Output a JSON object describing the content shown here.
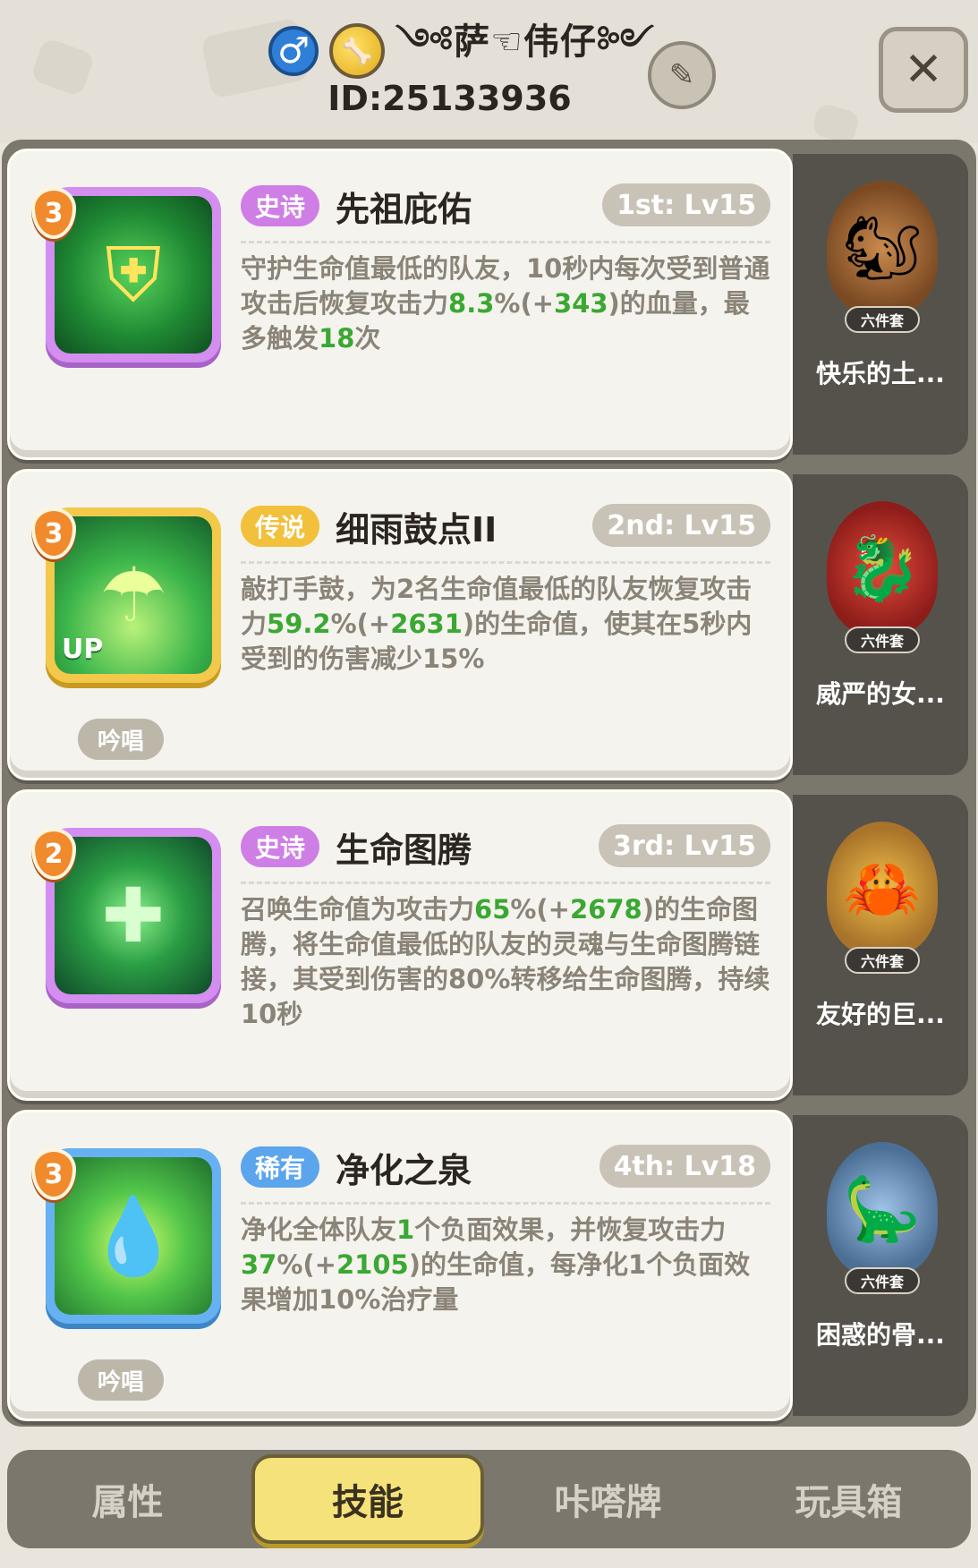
{
  "header": {
    "gender_icon": "male-symbol-icon",
    "player_name": "༺萨☜伟仔༻",
    "player_id": "ID:25133936",
    "edit_icon": "pencil-icon",
    "close_icon": "close-icon"
  },
  "skills": [
    {
      "badge": "3",
      "rarity": "史诗",
      "name": "先祖庇佑",
      "slot": "1st: Lv15",
      "desc": [
        {
          "t": "守护生命值最低的队友，10秒内每次受到普通攻击后恢复攻击力",
          "hl": false
        },
        {
          "t": "8.3",
          "hl": true
        },
        {
          "t": "%(+",
          "hl": false
        },
        {
          "t": "343",
          "hl": true
        },
        {
          "t": ")的血量，最多触发",
          "hl": false
        },
        {
          "t": "18",
          "hl": true
        },
        {
          "t": "次",
          "hl": false
        }
      ],
      "chant": "",
      "pet": {
        "set": "六件套",
        "name": "快乐的土..."
      }
    },
    {
      "badge": "3",
      "rarity": "传说",
      "name": "细雨鼓点II",
      "slot": "2nd: Lv15",
      "desc": [
        {
          "t": "敲打手鼓，为2名生命值最低的队友恢复攻击力",
          "hl": false
        },
        {
          "t": "59.2",
          "hl": true
        },
        {
          "t": "%(+",
          "hl": false
        },
        {
          "t": "2631",
          "hl": true
        },
        {
          "t": ")的生命值，使其在5秒内受到的伤害减少15%",
          "hl": false
        }
      ],
      "chant": "吟唱",
      "pet": {
        "set": "六件套",
        "name": "威严的女..."
      }
    },
    {
      "badge": "2",
      "rarity": "史诗",
      "name": "生命图腾",
      "slot": "3rd: Lv15",
      "desc": [
        {
          "t": "召唤生命值为攻击力",
          "hl": false
        },
        {
          "t": "65",
          "hl": true
        },
        {
          "t": "%(+",
          "hl": false
        },
        {
          "t": "2678",
          "hl": true
        },
        {
          "t": ")的生命图腾，将生命值最低的队友的灵魂与生命图腾链接，其受到伤害的80%转移给生命图腾，持续10秒",
          "hl": false
        }
      ],
      "chant": "",
      "pet": {
        "set": "六件套",
        "name": "友好的巨..."
      }
    },
    {
      "badge": "3",
      "rarity": "稀有",
      "name": "净化之泉",
      "slot": "4th: Lv18",
      "desc": [
        {
          "t": "净化全体队友",
          "hl": false
        },
        {
          "t": "1",
          "hl": true
        },
        {
          "t": "个负面效果，并恢复攻击力",
          "hl": false
        },
        {
          "t": "37",
          "hl": true
        },
        {
          "t": "%(+",
          "hl": false
        },
        {
          "t": "2105",
          "hl": true
        },
        {
          "t": ")的生命值，每净化1个负面效果增加10%治疗量",
          "hl": false
        }
      ],
      "chant": "吟唱",
      "pet": {
        "set": "六件套",
        "name": "困惑的骨..."
      }
    }
  ],
  "tabs": [
    "属性",
    "技能",
    "咔嗒牌",
    "玩具箱"
  ],
  "active_tab": "技能"
}
